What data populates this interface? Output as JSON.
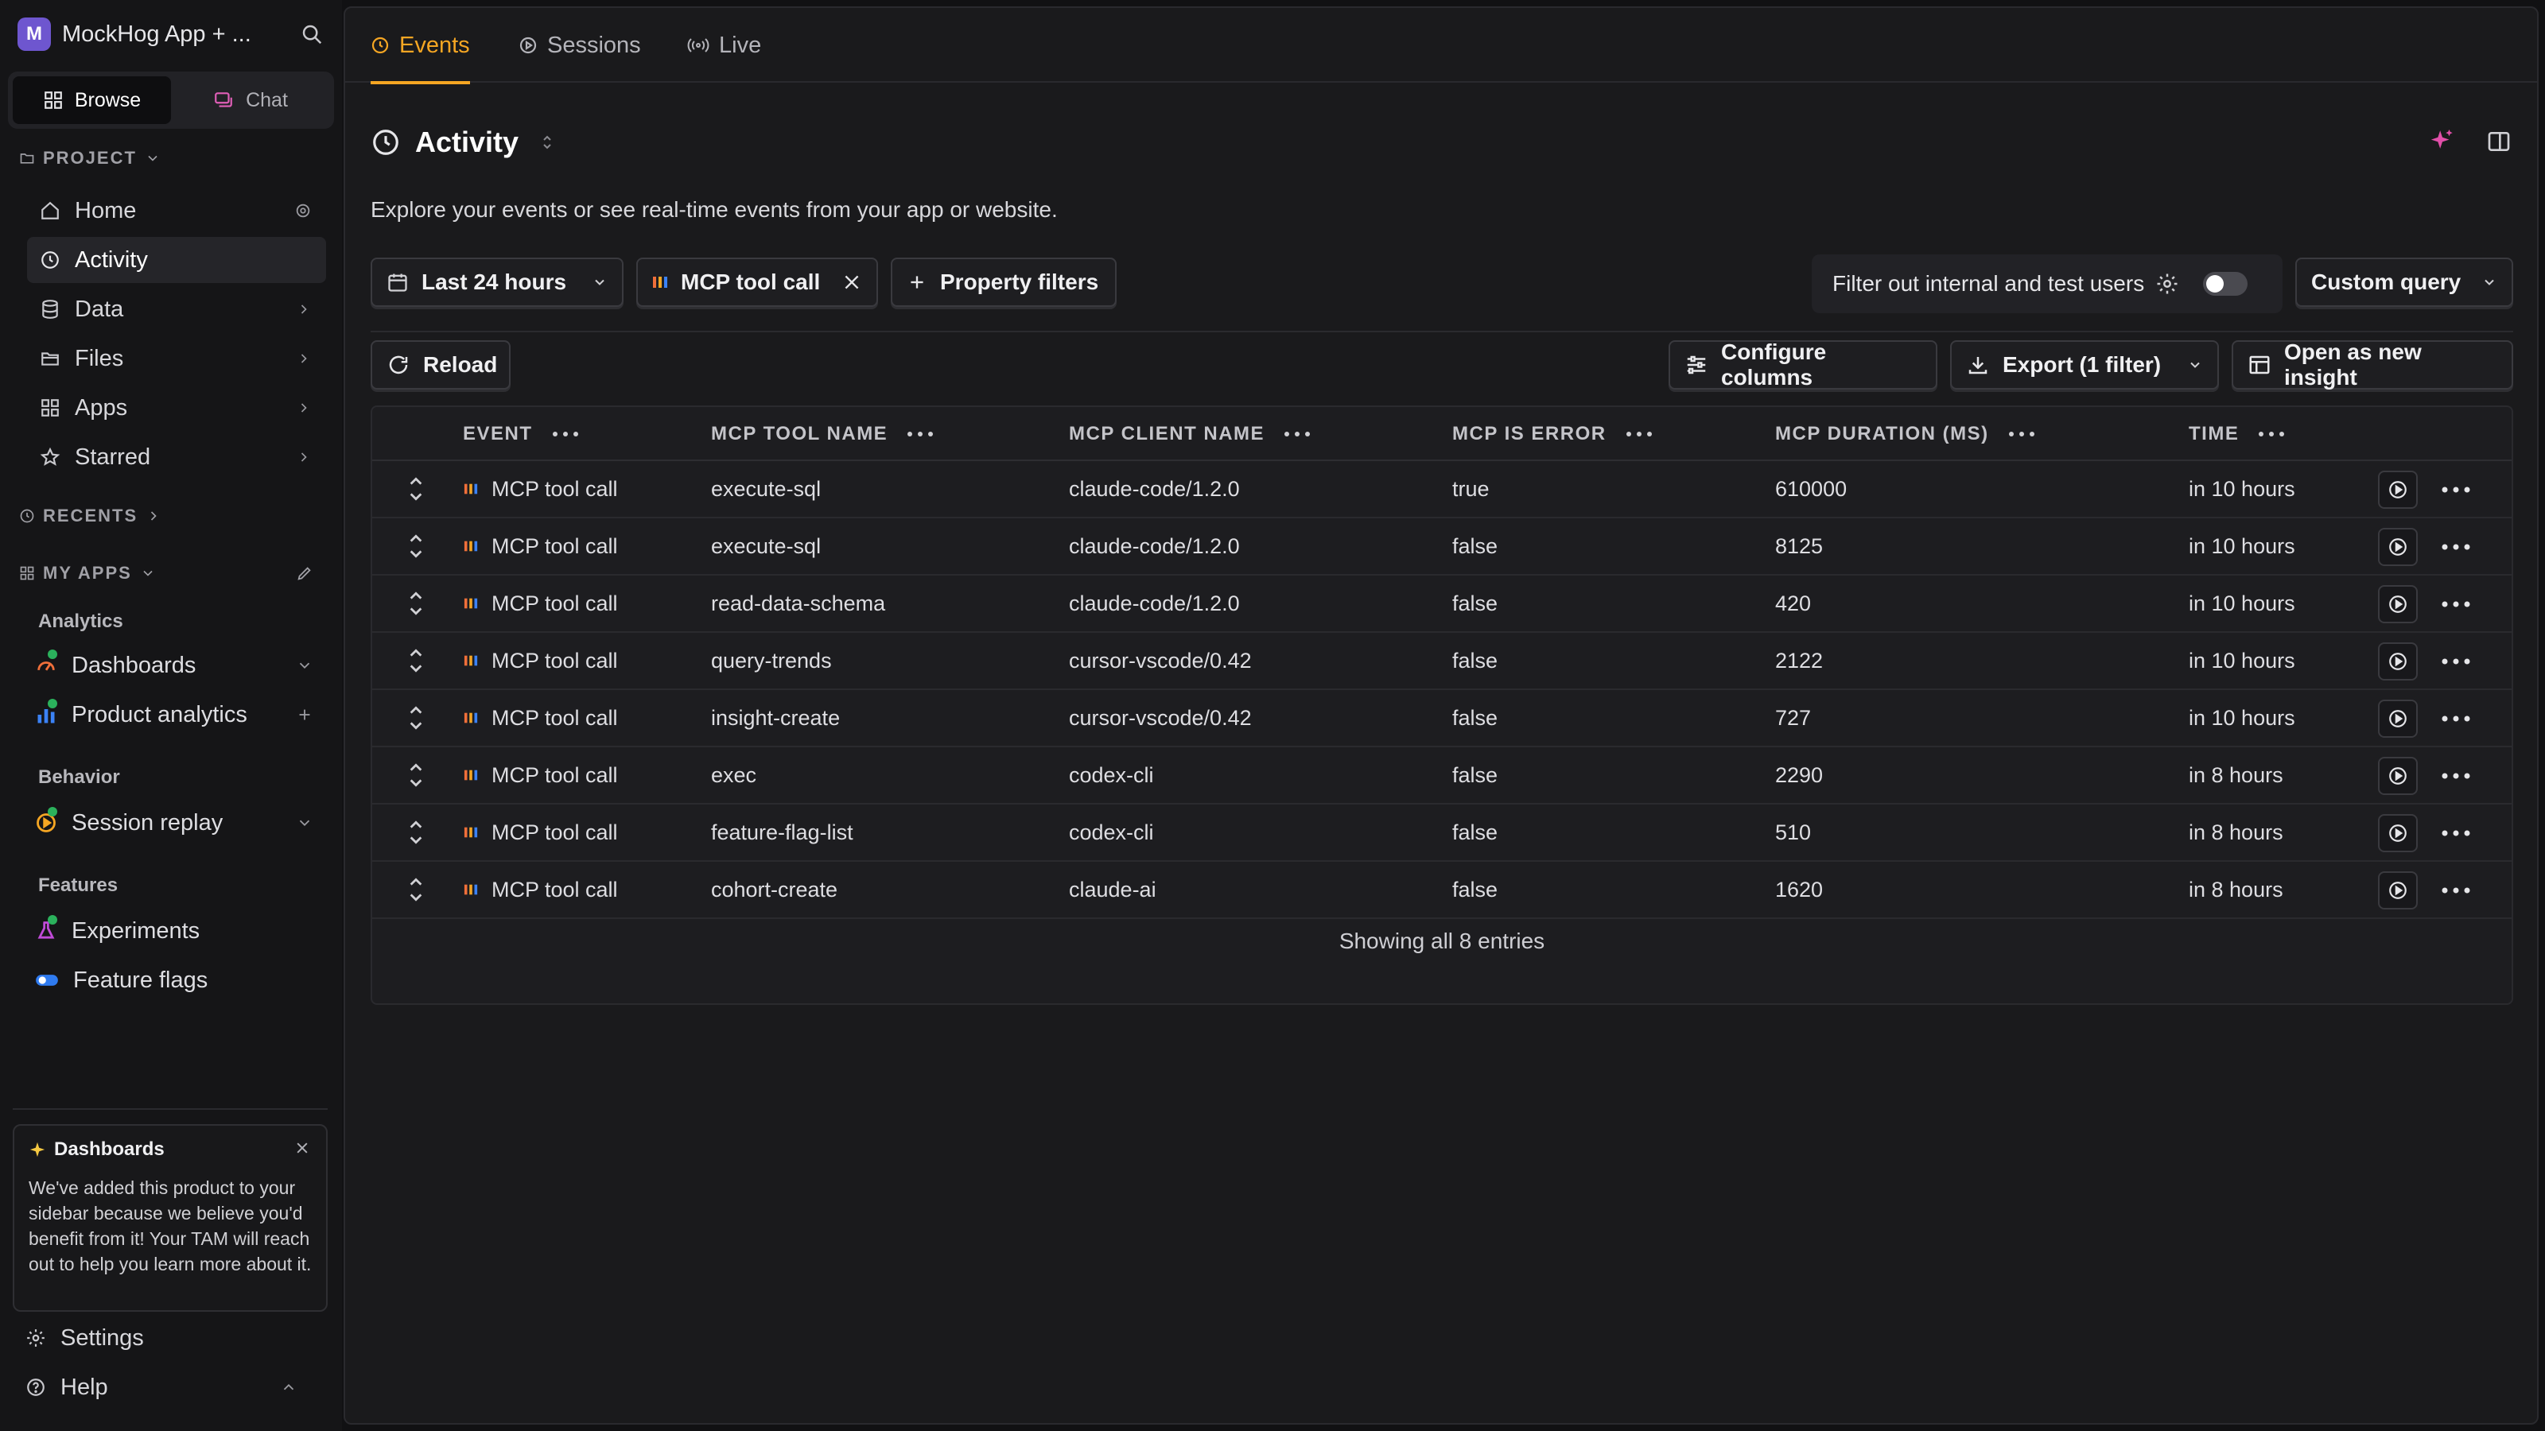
{
  "workspace": {
    "initial": "M",
    "name": "MockHog App + ..."
  },
  "sidebar": {
    "toggle": {
      "browse": "Browse",
      "chat": "Chat"
    },
    "project_label": "PROJECT",
    "project_items": [
      {
        "label": "Home"
      },
      {
        "label": "Activity"
      },
      {
        "label": "Data"
      },
      {
        "label": "Files"
      },
      {
        "label": "Apps"
      },
      {
        "label": "Starred"
      }
    ],
    "recents_label": "RECENTS",
    "my_apps_label": "MY APPS",
    "groups": {
      "analytics": "Analytics",
      "behavior": "Behavior",
      "features": "Features"
    },
    "apps": {
      "dashboards": "Dashboards",
      "product_analytics": "Product analytics",
      "session_replay": "Session replay",
      "experiments": "Experiments",
      "feature_flags": "Feature flags"
    },
    "tip": {
      "title": "Dashboards",
      "body": "We've added this product to your sidebar because we believe you'd benefit from it! Your TAM will reach out to help you learn more about it."
    },
    "settings": "Settings",
    "help": "Help"
  },
  "tabs": [
    {
      "label": "Events"
    },
    {
      "label": "Sessions"
    },
    {
      "label": "Live"
    }
  ],
  "page": {
    "title": "Activity",
    "description": "Explore your events or see real-time events from your app or website."
  },
  "filters": {
    "date_range": "Last 24 hours",
    "event_chip": "MCP tool call",
    "property_filters": "Property filters",
    "internal_filter": "Filter out internal and test users",
    "custom_query": "Custom query"
  },
  "toolbar": {
    "reload": "Reload",
    "configure_columns": "Configure columns",
    "export": "Export (1 filter)",
    "open_insight": "Open as new insight"
  },
  "table": {
    "columns": [
      "EVENT",
      "MCP TOOL NAME",
      "MCP CLIENT NAME",
      "MCP IS ERROR",
      "MCP DURATION (MS)",
      "TIME"
    ],
    "rows": [
      [
        "MCP tool call",
        "execute-sql",
        "claude-code/1.2.0",
        "true",
        "610000",
        "in 10 hours"
      ],
      [
        "MCP tool call",
        "execute-sql",
        "claude-code/1.2.0",
        "false",
        "8125",
        "in 10 hours"
      ],
      [
        "MCP tool call",
        "read-data-schema",
        "claude-code/1.2.0",
        "false",
        "420",
        "in 10 hours"
      ],
      [
        "MCP tool call",
        "query-trends",
        "cursor-vscode/0.42",
        "false",
        "2122",
        "in 10 hours"
      ],
      [
        "MCP tool call",
        "insight-create",
        "cursor-vscode/0.42",
        "false",
        "727",
        "in 10 hours"
      ],
      [
        "MCP tool call",
        "exec",
        "codex-cli",
        "false",
        "2290",
        "in 8 hours"
      ],
      [
        "MCP tool call",
        "feature-flag-list",
        "codex-cli",
        "false",
        "510",
        "in 8 hours"
      ],
      [
        "MCP tool call",
        "cohort-create",
        "claude-ai",
        "false",
        "1620",
        "in 8 hours"
      ]
    ],
    "footer": "Showing all 8 entries"
  },
  "colors": {
    "accent": "#f5a623",
    "workspace": "#6e56cf",
    "status_dot": "#2bb15c"
  }
}
